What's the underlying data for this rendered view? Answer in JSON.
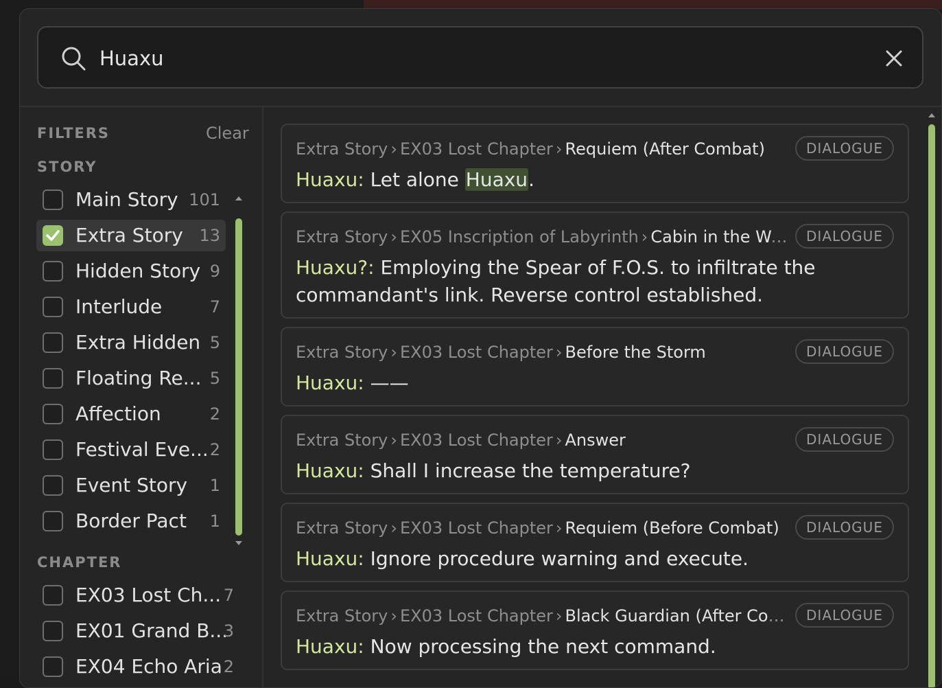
{
  "search": {
    "query": "Huaxu"
  },
  "filters": {
    "title": "FILTERS",
    "clear_label": "Clear",
    "story_title": "STORY",
    "story": [
      {
        "label": "Main Story",
        "count": "101",
        "checked": false
      },
      {
        "label": "Extra Story",
        "count": "13",
        "checked": true
      },
      {
        "label": "Hidden Story",
        "count": "9",
        "checked": false
      },
      {
        "label": "Interlude",
        "count": "7",
        "checked": false
      },
      {
        "label": "Extra Hidden",
        "count": "5",
        "checked": false
      },
      {
        "label": "Floating Re...",
        "count": "5",
        "checked": false
      },
      {
        "label": "Affection",
        "count": "2",
        "checked": false
      },
      {
        "label": "Festival Eve...",
        "count": "2",
        "checked": false
      },
      {
        "label": "Event Story",
        "count": "1",
        "checked": false
      },
      {
        "label": "Border Pact",
        "count": "1",
        "checked": false
      }
    ],
    "chapter_title": "CHAPTER",
    "chapter": [
      {
        "label": "EX03 Lost Ch...",
        "count": "7",
        "checked": false
      },
      {
        "label": "EX01 Grand B...",
        "count": "3",
        "checked": false
      },
      {
        "label": "EX04 Echo Aria",
        "count": "2",
        "checked": false
      }
    ]
  },
  "results": [
    {
      "category": "Extra Story",
      "chapter": "EX03 Lost Chapter",
      "scene": "Requiem (After Combat)",
      "badge": "DIALOGUE",
      "speaker": "Huaxu:",
      "text_before": "Let alone ",
      "highlight": "Huaxu",
      "text_after": "."
    },
    {
      "category": "Extra Story",
      "chapter": "EX05 Inscription of Labyrinth",
      "scene": "Cabin in the Wood...",
      "badge": "DIALOGUE",
      "speaker": "Huaxu?:",
      "text_before": "Employing the Spear of F.O.S. to infiltrate the commandant's link. Reverse control established.",
      "highlight": "",
      "text_after": ""
    },
    {
      "category": "Extra Story",
      "chapter": "EX03 Lost Chapter",
      "scene": "Before the Storm",
      "badge": "DIALOGUE",
      "speaker": "Huaxu:",
      "text_before": "——",
      "highlight": "",
      "text_after": ""
    },
    {
      "category": "Extra Story",
      "chapter": "EX03 Lost Chapter",
      "scene": "Answer",
      "badge": "DIALOGUE",
      "speaker": "Huaxu:",
      "text_before": "Shall I increase the temperature?",
      "highlight": "",
      "text_after": ""
    },
    {
      "category": "Extra Story",
      "chapter": "EX03 Lost Chapter",
      "scene": "Requiem (Before Combat)",
      "badge": "DIALOGUE",
      "speaker": "Huaxu:",
      "text_before": "Ignore procedure warning and execute.",
      "highlight": "",
      "text_after": ""
    },
    {
      "category": "Extra Story",
      "chapter": "EX03 Lost Chapter",
      "scene": "Black Guardian (After Combat)",
      "badge": "DIALOGUE",
      "speaker": "Huaxu:",
      "text_before": "Now processing the next command.",
      "highlight": "",
      "text_after": ""
    }
  ],
  "colors": {
    "accent": "#9bc06e",
    "speaker": "#d6e69f",
    "highlight_bg": "#3f5130"
  }
}
